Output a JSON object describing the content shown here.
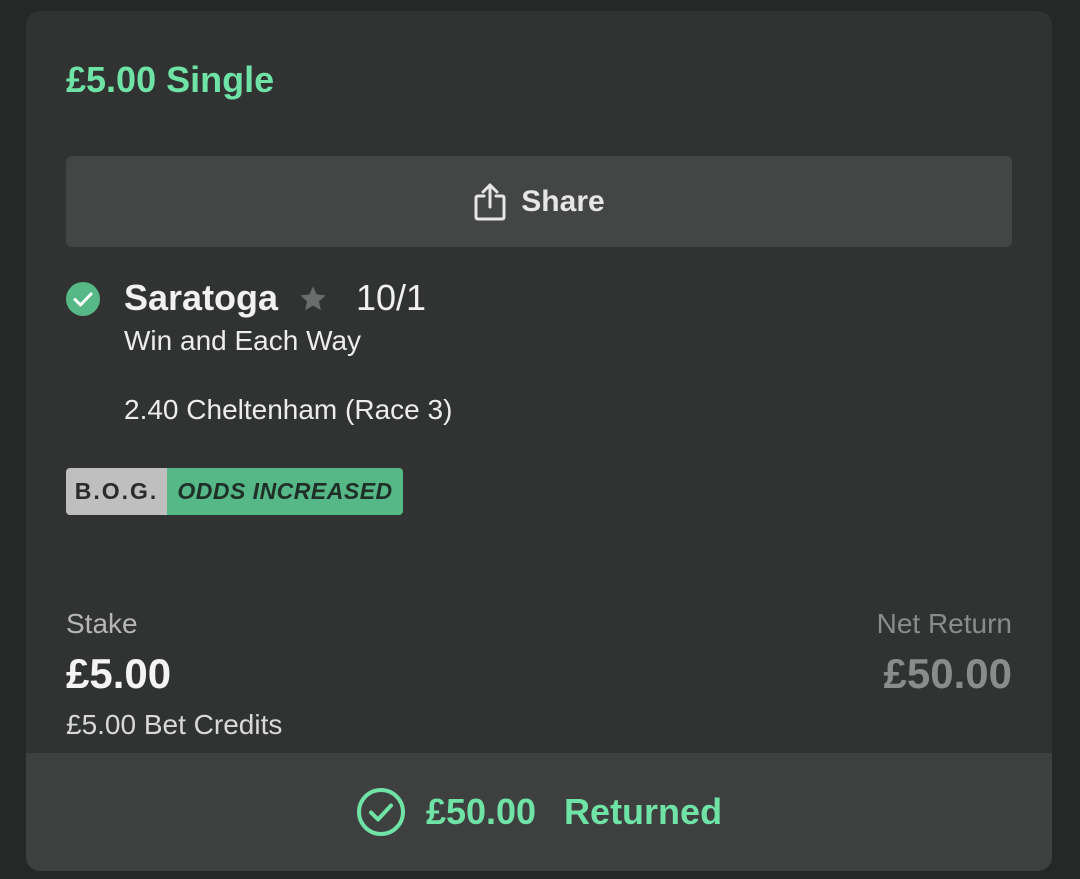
{
  "bet": {
    "title": "£5.00 Single"
  },
  "share": {
    "label": "Share",
    "icon": "share-icon"
  },
  "selection": {
    "name": "Saratoga",
    "odds": "10/1",
    "market": "Win and Each Way",
    "event": "2.40 Cheltenham (Race 3)",
    "status_icon": "check-circle-icon",
    "favourite_icon": "star-icon"
  },
  "badge": {
    "bog": "B.O.G.",
    "odds_increased": "ODDS INCREASED"
  },
  "stake": {
    "label": "Stake",
    "value": "£5.00",
    "credits": "£5.00 Bet Credits"
  },
  "net_return": {
    "label": "Net Return",
    "value": "£50.00"
  },
  "footer": {
    "amount": "£50.00",
    "status": "Returned",
    "icon": "check-circle-outline-icon"
  },
  "colors": {
    "accent": "#6fe2a6",
    "badge_green": "#55b886",
    "card_bg": "#303332",
    "page_bg": "#262727"
  }
}
